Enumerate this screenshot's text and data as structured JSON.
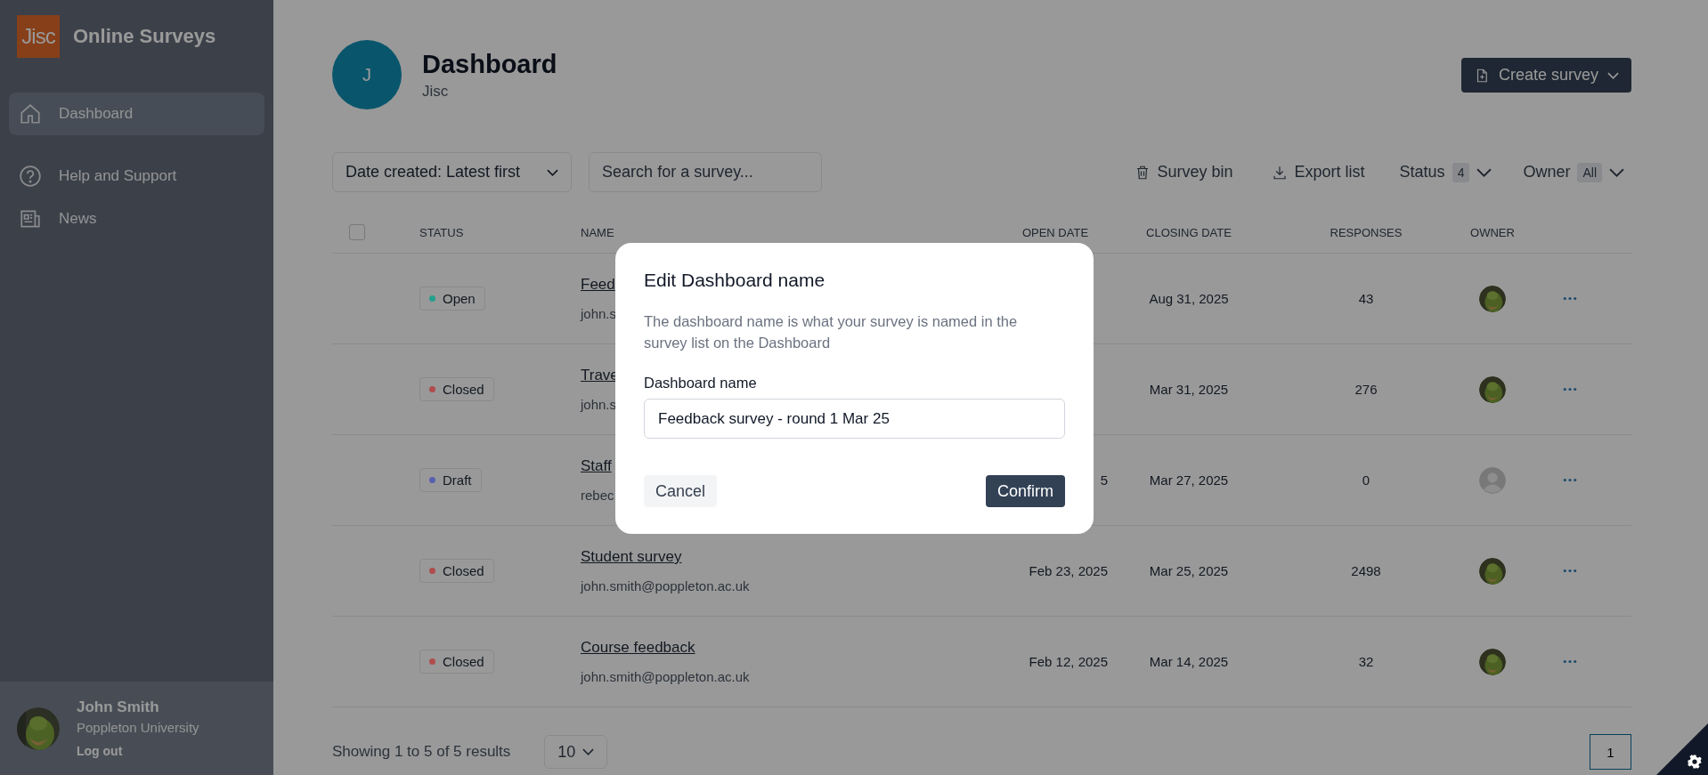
{
  "app": {
    "logo": "Jisc",
    "name": "Online Surveys"
  },
  "sidebar": {
    "items": [
      {
        "label": "Dashboard",
        "selected": true
      },
      {
        "label": "Help and Support",
        "selected": false
      },
      {
        "label": "News",
        "selected": false
      }
    ]
  },
  "user": {
    "name": "John Smith",
    "org": "Poppleton University",
    "logout": "Log out"
  },
  "header": {
    "avatar_letter": "J",
    "title": "Dashboard",
    "subtitle": "Jisc",
    "create_button": "Create survey"
  },
  "toolbar": {
    "sort": "Date created: Latest first",
    "search_placeholder": "Search for a survey...",
    "bin": "Survey bin",
    "export": "Export list",
    "status_filter": {
      "label": "Status",
      "count": "4"
    },
    "owner_filter": {
      "label": "Owner",
      "value": "All"
    }
  },
  "table": {
    "select_all_checked": false,
    "columns": [
      "STATUS",
      "NAME",
      "OPEN DATE",
      "CLOSING DATE",
      "RESPONSES",
      "OWNER"
    ],
    "rows": [
      {
        "status": "Open",
        "color": "#24a08c",
        "name": "Feed",
        "email": "john.s",
        "closing_date": "Aug 31, 2025",
        "responses": "43"
      },
      {
        "status": "Closed",
        "color": "#b04c4c",
        "name": "Trave",
        "email": "john.s",
        "closing_date": "Mar 31, 2025",
        "responses": "276"
      },
      {
        "status": "Draft",
        "color": "#5a60b0",
        "name": "Staff",
        "email": "rebec",
        "open_date": "5",
        "closing_date": "Mar 27, 2025",
        "responses": "0",
        "owner": {
          "kind": "default"
        }
      },
      {
        "status": "Closed",
        "color": "#b04c4c",
        "name": "Student survey",
        "email": "john.smith@poppleton.ac.uk",
        "open_date": "Feb 23, 2025",
        "closing_date": "Mar 25, 2025",
        "responses": "2498"
      },
      {
        "status": "Closed",
        "color": "#b04c4c",
        "name": "Course feedback",
        "email": "john.smith@poppleton.ac.uk",
        "open_date": "Feb 12, 2025",
        "closing_date": "Mar 14, 2025",
        "responses": "32"
      }
    ]
  },
  "footer": {
    "summary": "Showing 1 to 5 of 5 results",
    "per_page": "10",
    "pages": [
      {
        "label": "1",
        "selected": true
      }
    ]
  },
  "modal": {
    "title": "Edit Dashboard name",
    "description": "The dashboard name is what your survey is named in the survey list on the Dashboard",
    "field_label": "Dashboard name",
    "value": "Feedback survey - round 1 Mar 25",
    "cancel": "Cancel",
    "confirm": "Confirm"
  }
}
